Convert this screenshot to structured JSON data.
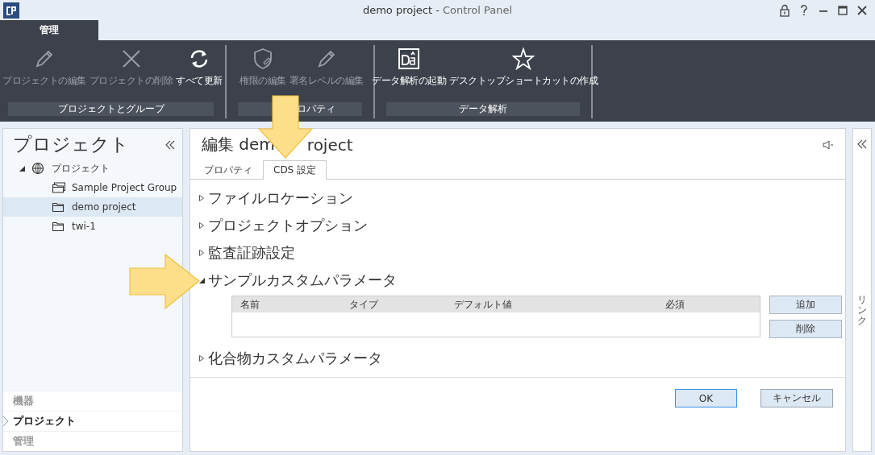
{
  "window": {
    "title": "demo project -",
    "app_name": "Control Panel"
  },
  "ribbon": {
    "tabs": [
      {
        "label": "管理",
        "selected": true
      }
    ],
    "groups": [
      {
        "label": "プロジェクトとグループ",
        "buttons": [
          {
            "label": "プロジェクトの編集",
            "kind": "pencil",
            "disabled": true
          },
          {
            "label": "プロジェクトの削除",
            "kind": "cross",
            "disabled": true
          },
          {
            "label": "すべて更新",
            "kind": "refresh",
            "disabled": false
          }
        ]
      },
      {
        "label": "ロパティ",
        "buttons": [
          {
            "label": "権限の編集",
            "kind": "shield",
            "disabled": true
          },
          {
            "label": "署名レベルの編集",
            "kind": "pencil",
            "disabled": true
          }
        ]
      },
      {
        "label": "データ解析",
        "buttons": [
          {
            "label": "データ解析の起動",
            "kind": "da",
            "disabled": false
          },
          {
            "label": "デスクトップショートカットの作成",
            "kind": "star",
            "disabled": false
          }
        ]
      }
    ]
  },
  "sidebar": {
    "title": "プロジェクト",
    "tree": [
      {
        "label": "プロジェクト",
        "kind": "globe",
        "expanded": true,
        "selected": false,
        "children": [
          {
            "label": "Sample Project Group",
            "kind": "group",
            "selected": false
          },
          {
            "label": "demo project",
            "kind": "folder",
            "selected": true
          },
          {
            "label": "twi-1",
            "kind": "folder",
            "selected": false
          }
        ]
      }
    ],
    "nav": [
      {
        "label": "機器",
        "selected": false
      },
      {
        "label": "プロジェクト",
        "selected": true
      },
      {
        "label": "管理",
        "selected": false
      }
    ]
  },
  "editor": {
    "title_parts": [
      "編集 dem",
      "roject"
    ],
    "tabs": [
      {
        "label": "プロパティ",
        "selected": false
      },
      {
        "label": "CDS 設定",
        "selected": true
      }
    ],
    "sections": [
      {
        "label": "ファイルロケーション",
        "expanded": false
      },
      {
        "label": "プロジェクトオプション",
        "expanded": false
      },
      {
        "label": "監査証跡設定",
        "expanded": false
      },
      {
        "label": "サンプルカスタムパラメータ",
        "expanded": true,
        "table": {
          "columns": [
            "名前",
            "タイプ",
            "デフォルト値",
            "必須"
          ]
        },
        "buttons": [
          "追加",
          "削除"
        ]
      },
      {
        "label": "化合物カスタムパラメータ",
        "expanded": false
      }
    ],
    "footer_buttons": [
      {
        "label": "OK",
        "default": true
      },
      {
        "label": "キャンセル",
        "default": false
      }
    ]
  },
  "right_panel": {
    "label": "リンク"
  }
}
